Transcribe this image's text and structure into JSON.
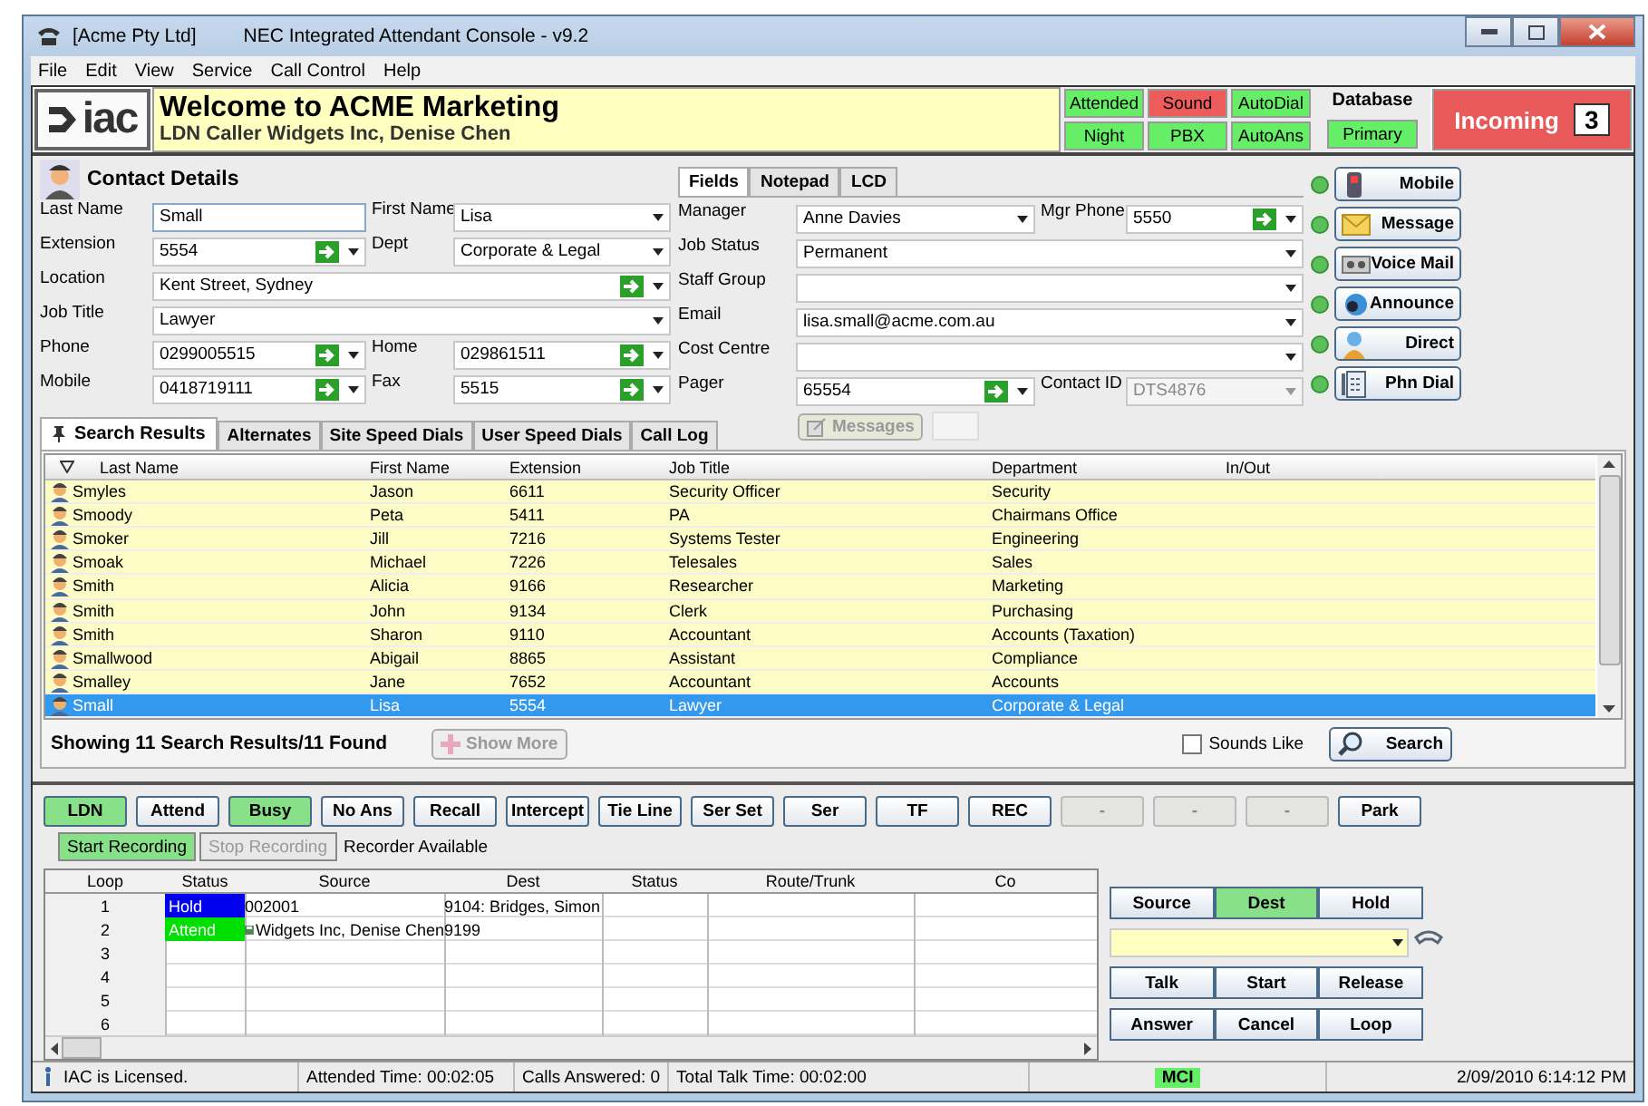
{
  "window": {
    "company": "[Acme Pty Ltd]",
    "title": "NEC Integrated Attendant Console  - v9.2"
  },
  "menu": [
    "File",
    "Edit",
    "View",
    "Service",
    "Call Control",
    "Help"
  ],
  "header": {
    "logo": "iac",
    "welcome": "Welcome to ACME Marketing",
    "caller": "LDN Caller Widgets Inc, Denise Chen"
  },
  "indicators": [
    {
      "label": "Attended",
      "color": "#66ee66"
    },
    {
      "label": "Sound",
      "color": "#ee5b5b"
    },
    {
      "label": "AutoDial",
      "color": "#66ee66"
    },
    {
      "label": "Night",
      "color": "#66ee66"
    },
    {
      "label": "PBX",
      "color": "#66ee66"
    },
    {
      "label": "AutoAns",
      "color": "#66ee66"
    }
  ],
  "database": {
    "title": "Database",
    "value": "Primary"
  },
  "incoming": {
    "label": "Incoming",
    "count": "3"
  },
  "contact": {
    "title": "Contact Details",
    "left_rows": [
      [
        {
          "label": "Last Name",
          "value": "Small",
          "kind": "text"
        },
        {
          "label": "First Name",
          "value": "Lisa",
          "kind": "combo"
        }
      ],
      [
        {
          "label": "Extension",
          "value": "5554",
          "kind": "dial"
        },
        {
          "label": "Dept",
          "value": "Corporate & Legal",
          "kind": "combo"
        }
      ],
      [
        {
          "label": "Location",
          "value": "Kent Street, Sydney",
          "kind": "dial"
        }
      ],
      [
        {
          "label": "Job Title",
          "value": "Lawyer",
          "kind": "combo"
        }
      ],
      [
        {
          "label": "Phone",
          "value": "0299005515",
          "kind": "dial"
        },
        {
          "label": "Home",
          "value": "029861511",
          "kind": "dial"
        }
      ],
      [
        {
          "label": "Mobile",
          "value": "0418719111",
          "kind": "dial"
        },
        {
          "label": "Fax",
          "value": "5515",
          "kind": "dial"
        }
      ]
    ],
    "tabs": [
      {
        "label": "Fields",
        "selected": true
      },
      {
        "label": "Notepad",
        "selected": false
      },
      {
        "label": "LCD",
        "selected": false
      }
    ],
    "right_rows": [
      [
        {
          "label": "Manager",
          "value": "Anne Davies",
          "kind": "combo"
        },
        {
          "label": "Mgr Phone",
          "value": "5550",
          "kind": "dial"
        }
      ],
      [
        {
          "label": "Job Status",
          "value": "Permanent",
          "kind": "combo"
        }
      ],
      [
        {
          "label": "Staff Group",
          "kind": "combo"
        }
      ],
      [
        {
          "label": "Email",
          "value": "lisa.small@acme.com.au",
          "kind": "combo"
        }
      ],
      [
        {
          "label": "Cost Centre",
          "kind": "combo"
        }
      ],
      [
        {
          "label": "Pager",
          "value": "65554",
          "kind": "dial"
        },
        {
          "label": "Contact ID",
          "value": "DTS4876",
          "kind": "locked"
        }
      ]
    ],
    "messages_button": {
      "label": "Messages",
      "disabled": true
    },
    "actions": [
      {
        "label": "Mobile",
        "kind": "mobile"
      },
      {
        "label": "Message",
        "kind": "message"
      },
      {
        "label": "Voice Mail",
        "kind": "voicemail"
      },
      {
        "label": "Announce",
        "kind": "announce"
      },
      {
        "label": "Direct",
        "kind": "direct"
      },
      {
        "label": "Phn Dial",
        "kind": "dial"
      }
    ]
  },
  "search_tabs": [
    {
      "label": "Search Results",
      "selected": true
    },
    {
      "label": "Alternates",
      "selected": false
    },
    {
      "label": "Site Speed Dials",
      "selected": false
    },
    {
      "label": "User Speed Dials",
      "selected": false
    },
    {
      "label": "Call Log",
      "selected": false
    }
  ],
  "results": {
    "columns": [
      "Last Name",
      "First Name",
      "Extension",
      "Job Title",
      "Department",
      "In/Out"
    ],
    "rows": [
      {
        "cells": [
          "Smyles",
          "Jason",
          "6611",
          "Security Officer",
          "Security"
        ],
        "selected": false
      },
      {
        "cells": [
          "Smoody",
          "Peta",
          "5411",
          "PA",
          "Chairmans Office"
        ],
        "selected": false
      },
      {
        "cells": [
          "Smoker",
          "Jill",
          "7216",
          "Systems Tester",
          "Engineering"
        ],
        "selected": false
      },
      {
        "cells": [
          "Smoak",
          "Michael",
          "7226",
          "Telesales",
          "Sales"
        ],
        "selected": false
      },
      {
        "cells": [
          "Smith",
          "Alicia",
          "9166",
          "Researcher",
          "Marketing"
        ],
        "selected": false
      },
      {
        "cells": [
          "Smith",
          "John",
          "9134",
          "Clerk",
          "Purchasing"
        ],
        "selected": false
      },
      {
        "cells": [
          "Smith",
          "Sharon",
          "9110",
          "Accountant",
          "Accounts (Taxation)"
        ],
        "selected": false
      },
      {
        "cells": [
          "Smallwood",
          "Abigail",
          "8865",
          "Assistant",
          "Compliance"
        ],
        "selected": false
      },
      {
        "cells": [
          "Smalley",
          "Jane",
          "7652",
          "Accountant",
          "Accounts"
        ],
        "selected": false
      },
      {
        "cells": [
          "Small",
          "Lisa",
          "5554",
          "Lawyer",
          "Corporate & Legal"
        ],
        "selected": true
      }
    ],
    "summary": "Showing 11 Search Results/11 Found",
    "show_more": {
      "label": "Show More",
      "disabled": true
    },
    "sounds_like": {
      "label": "Sounds Like",
      "checked": false
    },
    "search_button": "Search"
  },
  "call_buttons": [
    {
      "label": "LDN",
      "active": true,
      "disabled": false
    },
    {
      "label": "Attend",
      "active": false,
      "disabled": false
    },
    {
      "label": "Busy",
      "active": true,
      "disabled": false
    },
    {
      "label": "No Ans",
      "active": false,
      "disabled": false
    },
    {
      "label": "Recall",
      "active": false,
      "disabled": false
    },
    {
      "label": "Intercept",
      "active": false,
      "disabled": false
    },
    {
      "label": "Tie Line",
      "active": false,
      "disabled": false
    },
    {
      "label": "Ser Set",
      "active": false,
      "disabled": false
    },
    {
      "label": "Ser",
      "active": false,
      "disabled": false
    },
    {
      "label": "TF",
      "active": false,
      "disabled": false
    },
    {
      "label": "REC",
      "active": false,
      "disabled": false
    },
    {
      "label": "-",
      "active": false,
      "disabled": true
    },
    {
      "label": "-",
      "active": false,
      "disabled": true
    },
    {
      "label": "-",
      "active": false,
      "disabled": true
    },
    {
      "label": "Park",
      "active": false,
      "disabled": false
    }
  ],
  "recording": {
    "start": {
      "label": "Start Recording",
      "active": true
    },
    "stop": {
      "label": "Stop Recording",
      "disabled": true
    },
    "status": "Recorder Available"
  },
  "loops": {
    "columns": [
      "Loop",
      "Status",
      "Source",
      "Dest",
      "Status",
      "Route/Trunk",
      "Co"
    ],
    "rows": [
      {
        "loop": "1",
        "status": "Hold",
        "color": "#0000ee",
        "source": "002001",
        "dest": "9104: Bridges, Simon"
      },
      {
        "loop": "2",
        "status": "Attend",
        "color": "#00e000",
        "source": "Widgets Inc, Denise Chen",
        "dest": "9199",
        "saved": true
      },
      {
        "loop": "3"
      },
      {
        "loop": "4"
      },
      {
        "loop": "5"
      },
      {
        "loop": "6"
      }
    ]
  },
  "call_control": {
    "tabs": [
      {
        "label": "Source",
        "selected": false
      },
      {
        "label": "Dest",
        "selected": true
      },
      {
        "label": "Hold",
        "selected": false
      }
    ],
    "rows": [
      [
        "Talk",
        "Start",
        "Release"
      ],
      [
        "Answer",
        "Cancel",
        "Loop"
      ]
    ]
  },
  "status_bar": {
    "license": "IAC is Licensed.",
    "attended_time": "Attended Time: 00:02:05",
    "calls_answered": "Calls Answered: 0",
    "talk_time": "Total Talk Time: 00:02:00",
    "link": "MCI",
    "datetime": "2/09/2010 6:14:12 PM"
  }
}
